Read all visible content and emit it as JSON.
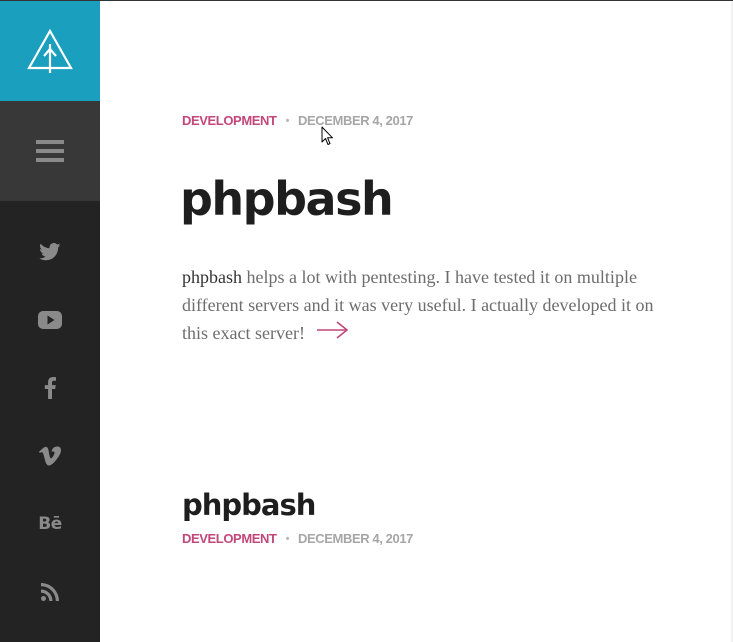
{
  "sidebar": {
    "logo_icon": "tree-logo-icon",
    "menu_icon": "hamburger-menu-icon",
    "social_icons": [
      "twitter-icon",
      "youtube-icon",
      "facebook-icon",
      "vimeo-icon",
      "behance-icon",
      "rss-icon"
    ],
    "behance_glyph": "Bē",
    "colors": {
      "logo_bg": "#1a9fbf",
      "menu_bg": "#383838",
      "sidebar_bg": "#232323",
      "icon": "#8a8a8a"
    }
  },
  "posts": [
    {
      "category": "DEVELOPMENT",
      "separator": "•",
      "date": "DECEMBER 4, 2017",
      "title": "phpbash",
      "excerpt_highlight": "phpbash",
      "excerpt_rest": " helps a lot with pentesting. I have tested it on multiple different servers and it was very useful. I actually developed it on this exact server!",
      "read_more_icon": "arrow-right-icon"
    },
    {
      "category": "DEVELOPMENT",
      "separator": "•",
      "date": "DECEMBER 4, 2017",
      "title": "phpbash"
    }
  ],
  "colors": {
    "category": "#c2477a",
    "date": "#a6a6a6",
    "title": "#1e1e1e",
    "excerpt": "#6d6d6d"
  }
}
